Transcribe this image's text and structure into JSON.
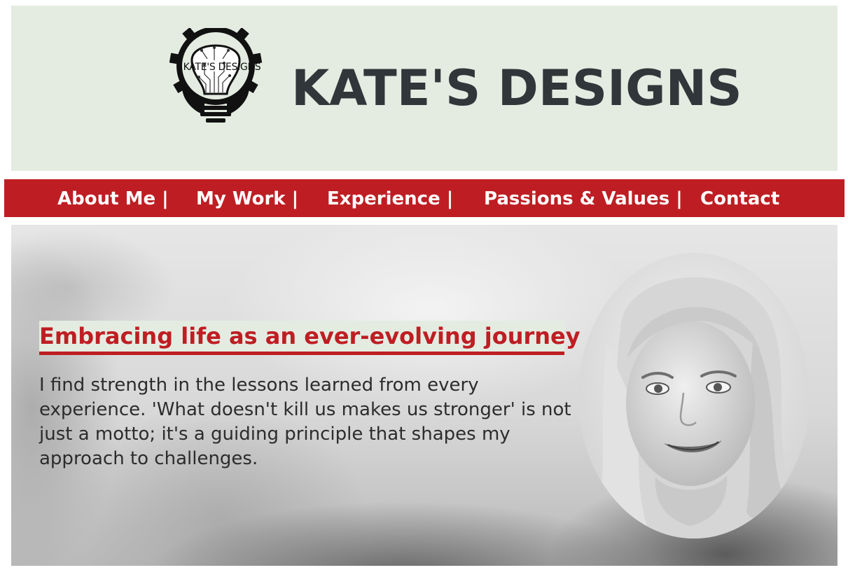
{
  "header": {
    "logo_text": "KATE'S DESIGNS",
    "title": "KATE'S DESIGNS",
    "background_color": "#e4ece2",
    "title_color": "#31363a"
  },
  "nav": {
    "background_color": "#be1e23",
    "items": [
      {
        "label": "About Me |"
      },
      {
        "label": "My Work |"
      },
      {
        "label": "Experience |"
      },
      {
        "label": "Passions & Values |"
      },
      {
        "label": "Contact"
      }
    ]
  },
  "hero": {
    "heading": "Embracing life as an ever-evolving journey",
    "paragraph": "I find strength in the lessons learned from every experience. 'What doesn't kill us makes us stronger' is not just a motto; it's a guiding principle that shapes my approach to challenges.",
    "accent_color": "#be1e23",
    "portrait_icon": "portrait-photo"
  }
}
